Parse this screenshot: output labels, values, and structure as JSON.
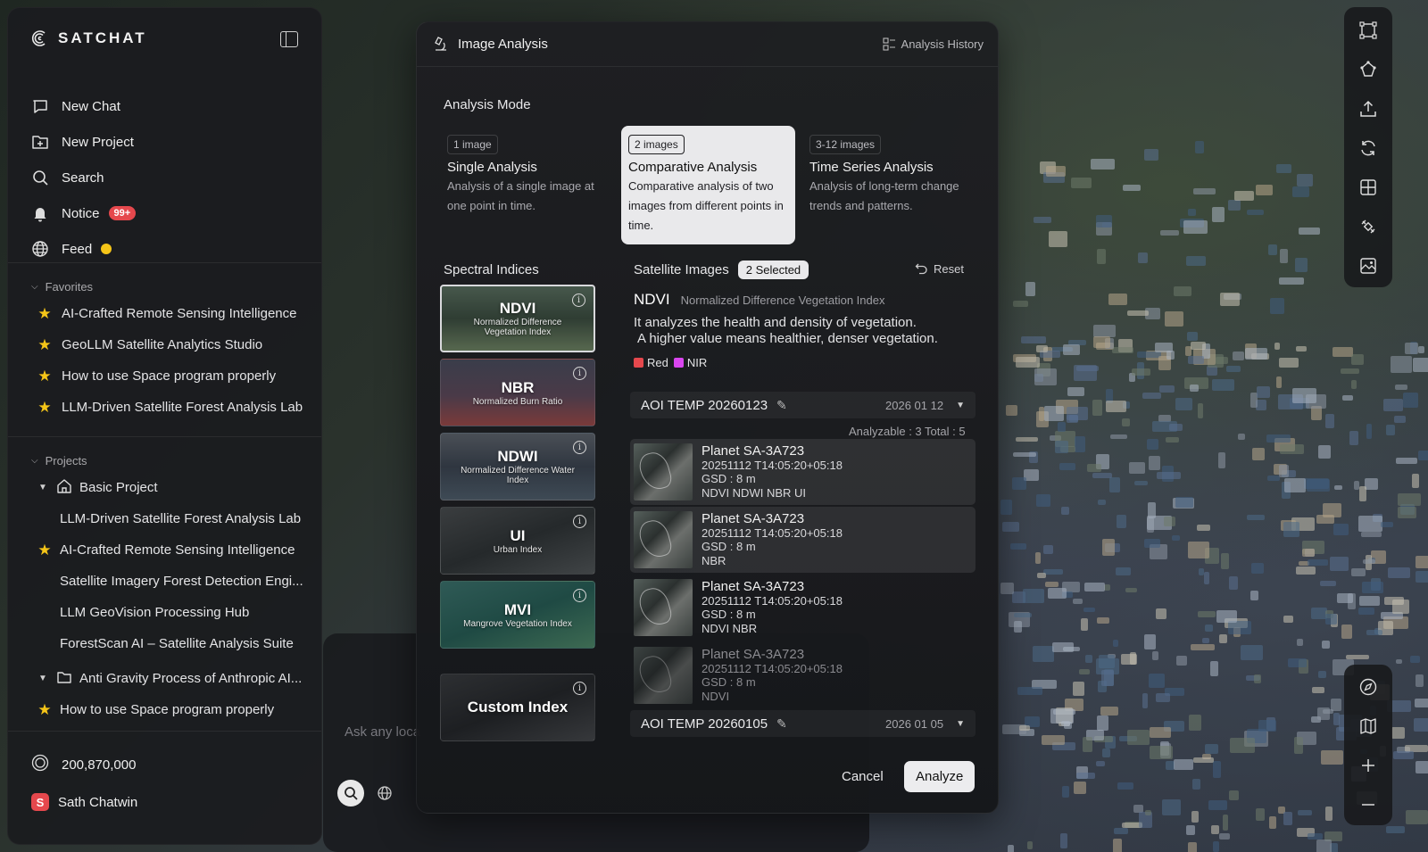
{
  "app": {
    "name": "SATCHAT"
  },
  "sidebar": {
    "menu": [
      {
        "label": "New Chat",
        "icon": "chat-icon"
      },
      {
        "label": "New Project",
        "icon": "folder-plus-icon"
      },
      {
        "label": "Search",
        "icon": "search-icon"
      },
      {
        "label": "Notice",
        "icon": "bell-icon",
        "badge": "99+"
      },
      {
        "label": "Feed",
        "icon": "globe-icon",
        "dot_color": "#f5c518"
      }
    ],
    "favorites_header": "Favorites",
    "favorites": [
      "AI-Crafted Remote Sensing Intelligence",
      "GeoLLM Satellite Analytics Studio",
      "How to use Space program properly",
      "LLM-Driven Satellite Forest Analysis Lab"
    ],
    "projects_header": "Projects",
    "projects": [
      {
        "label": "Basic Project",
        "type": "group-home",
        "expanded": true
      },
      {
        "label": "LLM-Driven Satellite Forest Analysis Lab",
        "type": "child"
      },
      {
        "label": "AI-Crafted Remote Sensing Intelligence",
        "type": "starred"
      },
      {
        "label": "Satellite Imagery Forest Detection Engi...",
        "type": "child"
      },
      {
        "label": "LLM GeoVision Processing Hub",
        "type": "child"
      },
      {
        "label": "ForestScan AI – Satellite Analysis Suite",
        "type": "child"
      },
      {
        "label": "Anti Gravity Process of Anthropic AI...",
        "type": "group-folder",
        "expanded": true
      },
      {
        "label": "How to use Space program properly",
        "type": "starred"
      }
    ],
    "credits": "200,870,000",
    "user": {
      "name": "Sath Chatwin",
      "initial": "S"
    }
  },
  "chat": {
    "placeholder": "Ask any loca"
  },
  "modal": {
    "title": "Image Analysis",
    "history_label": "Analysis History",
    "mode_label": "Analysis Mode",
    "modes": [
      {
        "tag": "1 image",
        "title": "Single Analysis",
        "desc": "Analysis of a single image at one point in time.",
        "selected": false
      },
      {
        "tag": "2 images",
        "title": "Comparative Analysis",
        "desc": "Comparative analysis of two images from different points in time.",
        "selected": true
      },
      {
        "tag": "3-12 images",
        "title": "Time Series Analysis",
        "desc": "Analysis of long-term change trends and patterns.",
        "selected": false
      }
    ],
    "spectral_label": "Spectral Indices",
    "indices": [
      {
        "abbr": "NDVI",
        "full": "Normalized Difference Vegetation Index",
        "active": true
      },
      {
        "abbr": "NBR",
        "full": "Normalized Burn Ratio",
        "active": false
      },
      {
        "abbr": "NDWI",
        "full": "Normalized Difference Water Index",
        "active": false
      },
      {
        "abbr": "UI",
        "full": "Urban Index",
        "active": false
      },
      {
        "abbr": "MVI",
        "full": "Mangrove Vegetation Index",
        "active": false
      },
      {
        "abbr": "Custom Index",
        "full": "",
        "active": false
      }
    ],
    "satellite_label": "Satellite Images",
    "selected_pill": "2 Selected",
    "reset_label": "Reset",
    "index_detail": {
      "abbr": "NDVI",
      "full": "Normalized Difference Vegetation Index",
      "line1": "It analyzes the health and density of vegetation.",
      "line2": "A higher value means healthier, denser vegetation.",
      "bands": [
        {
          "label": "Red",
          "color": "#e5484d"
        },
        {
          "label": "NIR",
          "color": "#d946ef"
        }
      ]
    },
    "aoi_1": {
      "name": "AOI TEMP 20260123",
      "date": "2026 01 12"
    },
    "counts": "Analyzable : 3   Total : 5",
    "images": [
      {
        "name": "Planet SA-3A723",
        "time": "20251112 T14:05:20+05:18",
        "gsd": "GSD : 8 m",
        "indices": "NDVI NDWI NBR UI",
        "selected": true,
        "dim": false
      },
      {
        "name": "Planet SA-3A723",
        "time": "20251112 T14:05:20+05:18",
        "gsd": "GSD : 8 m",
        "indices": "NBR",
        "selected": true,
        "dim": false
      },
      {
        "name": "Planet SA-3A723",
        "time": "20251112 T14:05:20+05:18",
        "gsd": "GSD : 8 m",
        "indices": "NDVI NBR",
        "selected": false,
        "dim": false
      },
      {
        "name": "Planet SA-3A723",
        "time": "20251112 T14:05:20+05:18",
        "gsd": "GSD : 8 m",
        "indices": "NDVI",
        "selected": false,
        "dim": true
      }
    ],
    "aoi_2": {
      "name": "AOI TEMP 20260105",
      "date": "2026 01 05"
    },
    "cancel_label": "Cancel",
    "analyze_label": "Analyze"
  },
  "toolbar_top": [
    "crop-frame-icon",
    "polygon-icon",
    "upload-icon",
    "refresh-icon",
    "grid-icon",
    "satellite-icon",
    "image-compare-icon"
  ],
  "toolbar_bottom": [
    "compass-icon",
    "map-icon",
    "zoom-in-icon",
    "zoom-out-icon"
  ]
}
